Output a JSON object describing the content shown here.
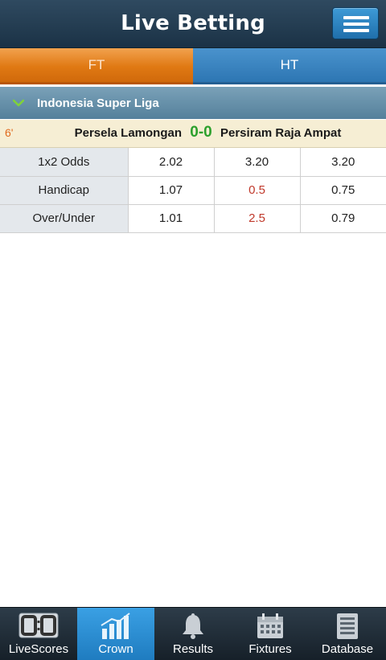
{
  "header": {
    "title": "Live Betting"
  },
  "tabs": [
    {
      "label": "FT",
      "active": true
    },
    {
      "label": "HT",
      "active": false
    }
  ],
  "league": {
    "name": "Indonesia Super Liga"
  },
  "match": {
    "minute": "6'",
    "home": "Persela Lamongan",
    "score": "0-0",
    "away": "Persiram Raja Ampat"
  },
  "odds": [
    {
      "label": "1x2 Odds",
      "v1": "2.02",
      "v2": "3.20",
      "v3": "3.20"
    },
    {
      "label": "Handicap",
      "v1": "1.07",
      "v2": "0.5",
      "v3": "0.75"
    },
    {
      "label": "Over/Under",
      "v1": "1.01",
      "v2": "2.5",
      "v3": "0.79"
    }
  ],
  "nav": [
    {
      "label": "LiveScores",
      "icon": "scoreboard-icon"
    },
    {
      "label": "Crown",
      "icon": "bar-chart-icon",
      "active": true
    },
    {
      "label": "Results",
      "icon": "bell-icon"
    },
    {
      "label": "Fixtures",
      "icon": "calendar-icon"
    },
    {
      "label": "Database",
      "icon": "database-icon"
    }
  ],
  "colors": {
    "accent_orange": "#e07913",
    "accent_blue": "#1f7cc0",
    "score_green": "#2ca02c",
    "line_red": "#c0392b"
  }
}
